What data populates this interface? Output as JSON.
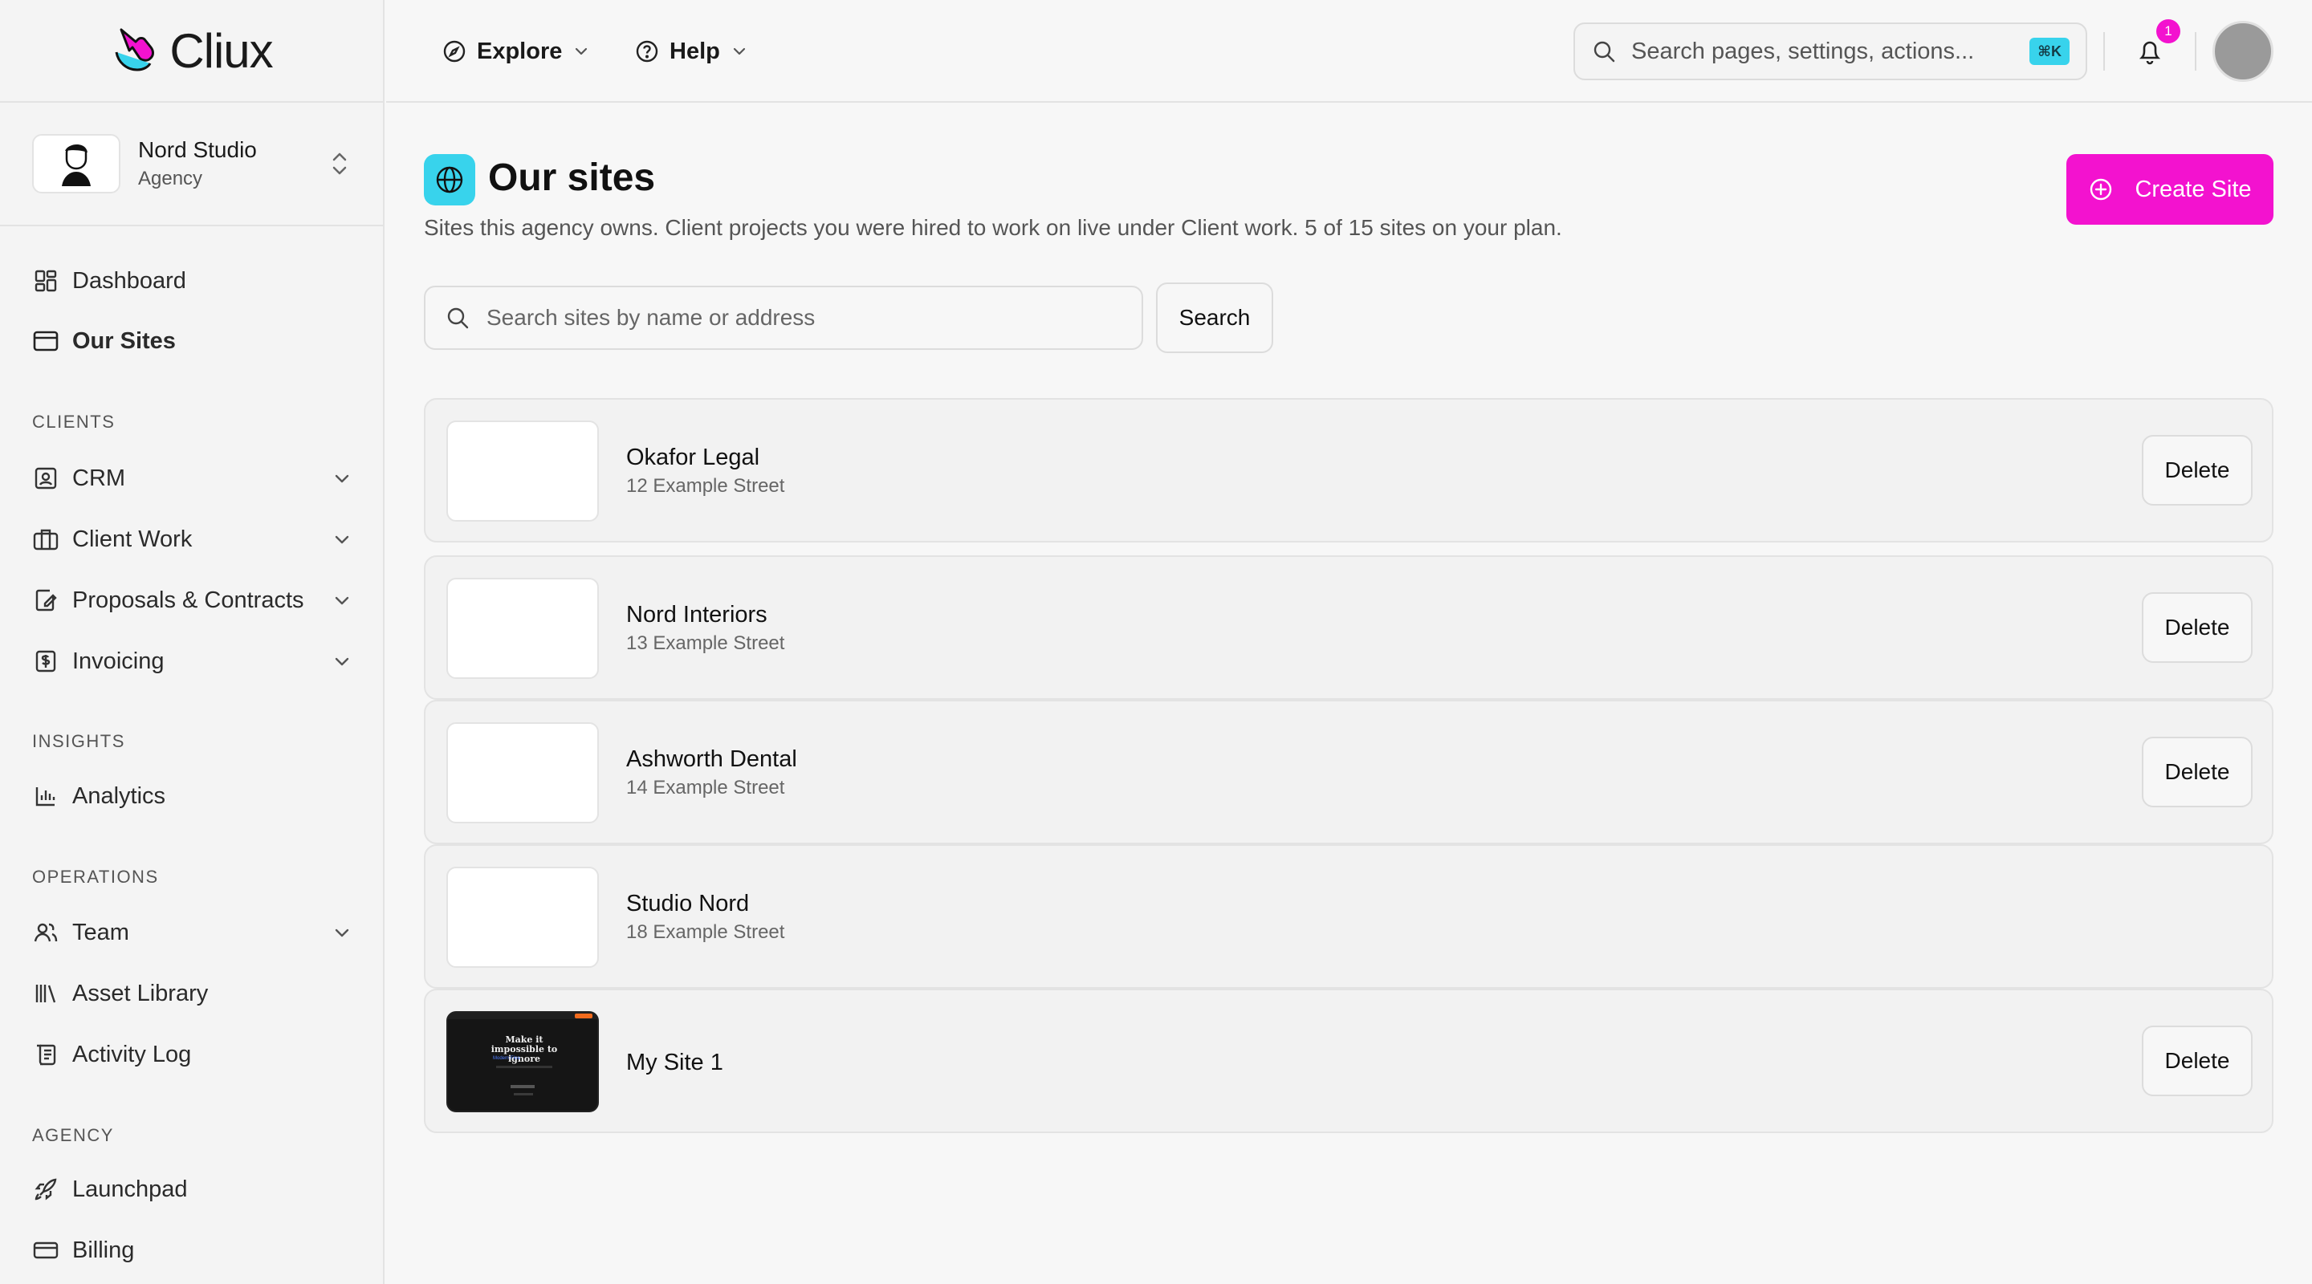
{
  "app": {
    "logo_text": "Cliux"
  },
  "org": {
    "name": "Nord Studio",
    "type": "Agency"
  },
  "sidebar": {
    "items": [
      {
        "label": "Dashboard"
      },
      {
        "label": "Our Sites",
        "active": true
      }
    ],
    "sections": [
      {
        "title": "CLIENTS",
        "items": [
          {
            "label": "CRM"
          },
          {
            "label": "Client Work"
          },
          {
            "label": "Proposals & Contracts"
          },
          {
            "label": "Invoicing"
          }
        ]
      },
      {
        "title": "INSIGHTS",
        "items": [
          {
            "label": "Analytics"
          }
        ]
      },
      {
        "title": "OPERATIONS",
        "items": [
          {
            "label": "Team"
          },
          {
            "label": "Asset Library"
          },
          {
            "label": "Activity Log"
          }
        ]
      },
      {
        "title": "AGENCY",
        "items": [
          {
            "label": "Launchpad"
          },
          {
            "label": "Billing"
          }
        ]
      }
    ]
  },
  "topbar": {
    "menus": [
      {
        "label": "Explore"
      },
      {
        "label": "Help"
      }
    ],
    "search": {
      "placeholder": "Search pages, settings, actions...",
      "shortcut": "⌘K"
    },
    "notifications": {
      "count": "1"
    }
  },
  "page": {
    "title": "Our sites",
    "subtitle": "Sites this agency owns. Client projects you were hired to work on live under Client work. 5 of 15 sites on your plan.",
    "create_label": "Create Site",
    "search": {
      "placeholder": "Search sites by name or address",
      "button": "Search"
    },
    "delete_label": "Delete",
    "sites": [
      {
        "name": "Okafor Legal",
        "address": "12 Example Street"
      },
      {
        "name": "Nord Interiors",
        "address": "13 Example Street"
      },
      {
        "name": "Ashworth Dental",
        "address": "14 Example Street"
      },
      {
        "name": "Studio Nord",
        "address": "18 Example Street"
      },
      {
        "name": "My Site 1",
        "address": ""
      }
    ],
    "preview": {
      "headline": "Make it impossible to ignore",
      "tagline": "Modern Fina"
    }
  },
  "colors": {
    "accent_pink": "#f312cf",
    "accent_cyan": "#38d3ec"
  }
}
